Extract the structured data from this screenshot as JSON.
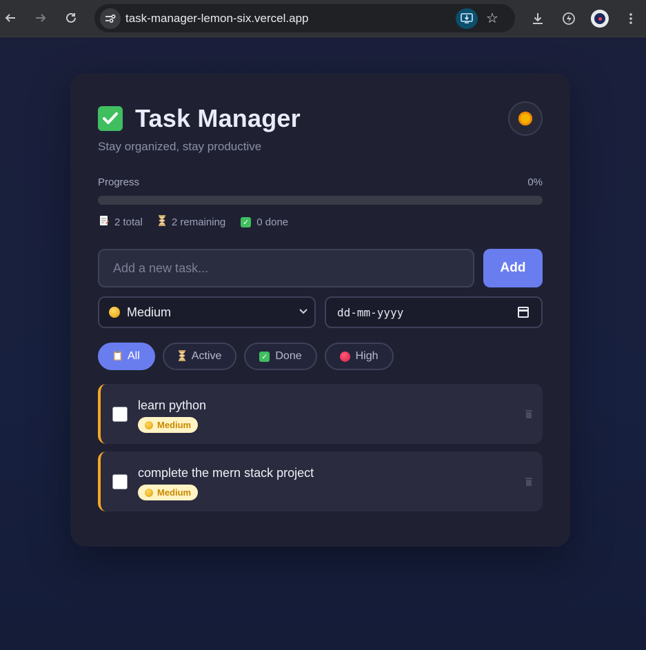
{
  "browser": {
    "url": "task-manager-lemon-six.vercel.app"
  },
  "app": {
    "title": "Task Manager",
    "subtitle": "Stay organized, stay productive",
    "theme_icon": "sun-icon"
  },
  "progress": {
    "label": "Progress",
    "percent_label": "0%",
    "percent": 0
  },
  "stats": {
    "total": "2 total",
    "remaining": "2 remaining",
    "done": "0 done"
  },
  "new_task": {
    "placeholder": "Add a new task...",
    "add_label": "Add",
    "priority_selected": "Medium",
    "date_placeholder": "dd-mm-yyyy"
  },
  "filters": [
    {
      "label": "All",
      "icon": "clipboard-icon",
      "active": true
    },
    {
      "label": "Active",
      "icon": "hourglass-icon",
      "active": false
    },
    {
      "label": "Done",
      "icon": "check-icon",
      "active": false
    },
    {
      "label": "High",
      "icon": "red-circle-icon",
      "active": false
    }
  ],
  "tasks": [
    {
      "text": "learn python",
      "priority": "Medium",
      "done": false
    },
    {
      "text": "complete the mern stack project",
      "priority": "Medium",
      "done": false
    }
  ],
  "colors": {
    "accent": "#6a7def",
    "medium_priority": "#f5a623",
    "card_bg": "#1f2133"
  }
}
